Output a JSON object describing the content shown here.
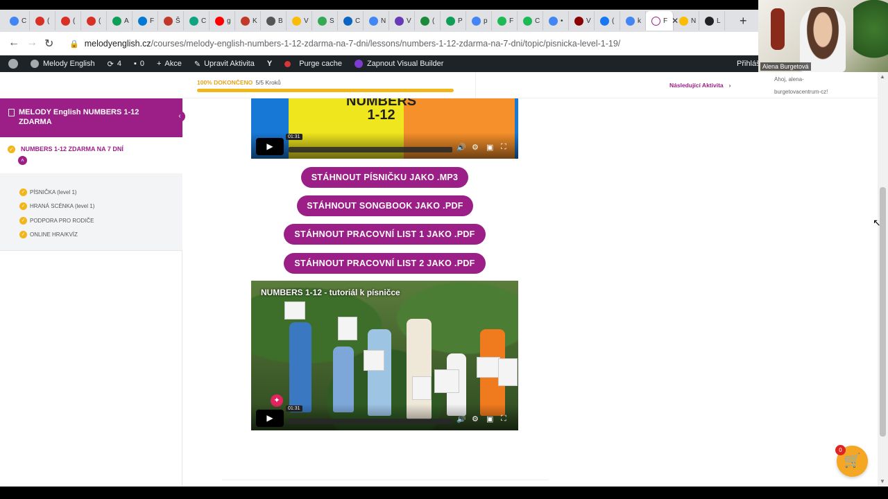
{
  "browser": {
    "tabs": [
      {
        "label": "C",
        "color": "#4285f4"
      },
      {
        "label": "(",
        "color": "#d93025"
      },
      {
        "label": "(",
        "color": "#d93025"
      },
      {
        "label": "(",
        "color": "#d93025"
      },
      {
        "label": "A",
        "color": "#0f9d58"
      },
      {
        "label": "F",
        "color": "#0078d4"
      },
      {
        "label": "Š",
        "color": "#c0392b"
      },
      {
        "label": "C",
        "color": "#10a37f"
      },
      {
        "label": "g",
        "color": "#ff0000"
      },
      {
        "label": "K",
        "color": "#c0392b"
      },
      {
        "label": "B",
        "color": "#555555"
      },
      {
        "label": "V",
        "color": "#fbbc04"
      },
      {
        "label": "S",
        "color": "#34a853"
      },
      {
        "label": "C",
        "color": "#0a66c2"
      },
      {
        "label": "N",
        "color": "#4285f4"
      },
      {
        "label": "V",
        "color": "#673ab7"
      },
      {
        "label": "(",
        "color": "#1b8a3a"
      },
      {
        "label": "P",
        "color": "#0f9d58"
      },
      {
        "label": "p",
        "color": "#4285f4"
      },
      {
        "label": "F",
        "color": "#1db954"
      },
      {
        "label": "C",
        "color": "#1db954"
      },
      {
        "label": "•",
        "color": "#4285f4"
      },
      {
        "label": "V",
        "color": "#8b0000"
      },
      {
        "label": "(",
        "color": "#1877f2"
      },
      {
        "label": "k",
        "color": "#4285f4"
      },
      {
        "label": "F",
        "color": "#ffffff",
        "active": true
      },
      {
        "label": "N",
        "color": "#fbbc04"
      },
      {
        "label": "L",
        "color": "#222222"
      }
    ],
    "new_tab": "+",
    "close": "✕",
    "url_host": "melodyenglish.cz",
    "url_path": "/courses/melody-english-numbers-1-12-zdarma-na-7-dni/lessons/numbers-1-12-zdarma-na-7-dni/topic/pisnicka-level-1-19/"
  },
  "wpbar": {
    "site": "Melody English",
    "updates": "4",
    "comments": "0",
    "new": "Akce",
    "edit": "Upravit Aktivita",
    "purge": "Purge cache",
    "builder": "Zapnout Visual Builder",
    "account": "Přihláš"
  },
  "webcam": {
    "name": "Alena Burgetová"
  },
  "progress": {
    "label": "100% DOKONČENO",
    "steps": "5/5 Kroků",
    "percent": 100,
    "next": "Následující Aktivita",
    "greeting": "Ahoj, alena-burgetovacentrum-cz!"
  },
  "sidebar": {
    "course_title": "MELODY English NUMBERS 1-12 ZDARMA",
    "lesson_title": "NUMBERS 1-12 ZDARMA NA 7 DNÍ",
    "topics": [
      "PÍSNIČKA (level 1)",
      "HRANÁ SCÉNKA (level 1)",
      "PODPORA PRO RODIČE",
      "ONLINE HRA/KVÍZ"
    ]
  },
  "video1": {
    "title_line1": "NUMBERS",
    "title_line2": "1-12",
    "time": "01:31"
  },
  "buttons": {
    "mp3": "STÁHNOUT PÍSNIČKU JAKO .MP3",
    "songbook": "STÁHNOUT SONGBOOK JAKO .PDF",
    "list1": "STÁHNOUT PRACOVNÍ LIST 1 JAKO .PDF",
    "list2": "STÁHNOUT PRACOVNÍ LIST 2 JAKO .PDF"
  },
  "video2": {
    "title": "NUMBERS 1-12 - tutoriál k písničce",
    "time": "01:31"
  },
  "cart": {
    "count": "0"
  },
  "colors": {
    "brand": "#9b1f86",
    "accent": "#f2b51a",
    "cart": "#f5a623"
  }
}
